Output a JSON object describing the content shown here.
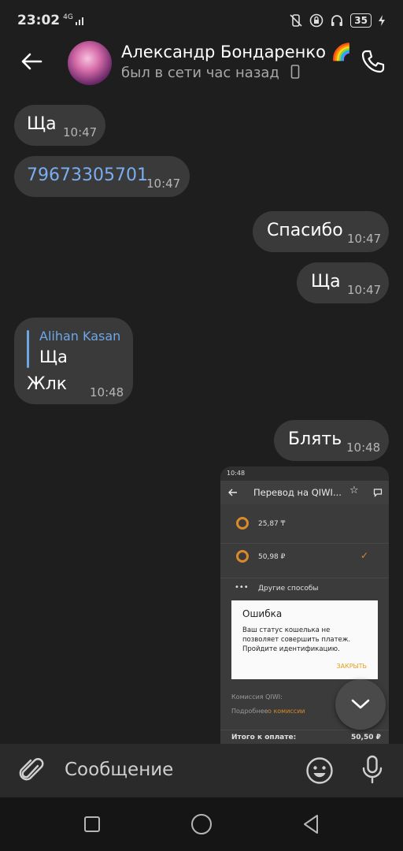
{
  "status_bar": {
    "time": "23:02",
    "network": "4G",
    "battery": "35"
  },
  "header": {
    "name": "Александр Бондаренко 🌈",
    "status": "был в сети час назад"
  },
  "messages": [
    {
      "text": "Ща",
      "time": "10:47",
      "side": "in"
    },
    {
      "text": "79673305701",
      "time": "10:47",
      "side": "in",
      "link": true
    },
    {
      "text": "Спасибо",
      "time": "10:47",
      "side": "out"
    },
    {
      "text": "Ща",
      "time": "10:47",
      "side": "out"
    },
    {
      "reply_author": "Alihan Kasan",
      "reply_text": "Ща",
      "text": "Жлк",
      "time": "10:48",
      "side": "in"
    },
    {
      "text": "Блять",
      "time": "10:48",
      "side": "out"
    }
  ],
  "screenshot": {
    "status_time": "10:48",
    "title": "Перевод на QIWI...",
    "row1": "25,87 ₸",
    "row2": "50,98 ₽",
    "row3": "Другие способы",
    "dialog_title": "Ошибка",
    "dialog_message": "Ваш статус кошелька не позволяет совершить платеж. Пройдите идентификацию.",
    "dialog_button": "ЗАКРЫТЬ",
    "commission_label": "Комиссия QIWI:",
    "more_label": "Подробнее",
    "more_link": "о комиссии",
    "total_label": "Итого к оплате:",
    "total_value": "50,50 ₽"
  },
  "input": {
    "placeholder": "Сообщение"
  },
  "icons": {
    "back": "arrow-left-icon",
    "call": "phone-icon",
    "attach": "paperclip-icon",
    "emoji": "smiley-icon",
    "mic": "microphone-icon",
    "scroll_down": "chevron-down-icon"
  }
}
